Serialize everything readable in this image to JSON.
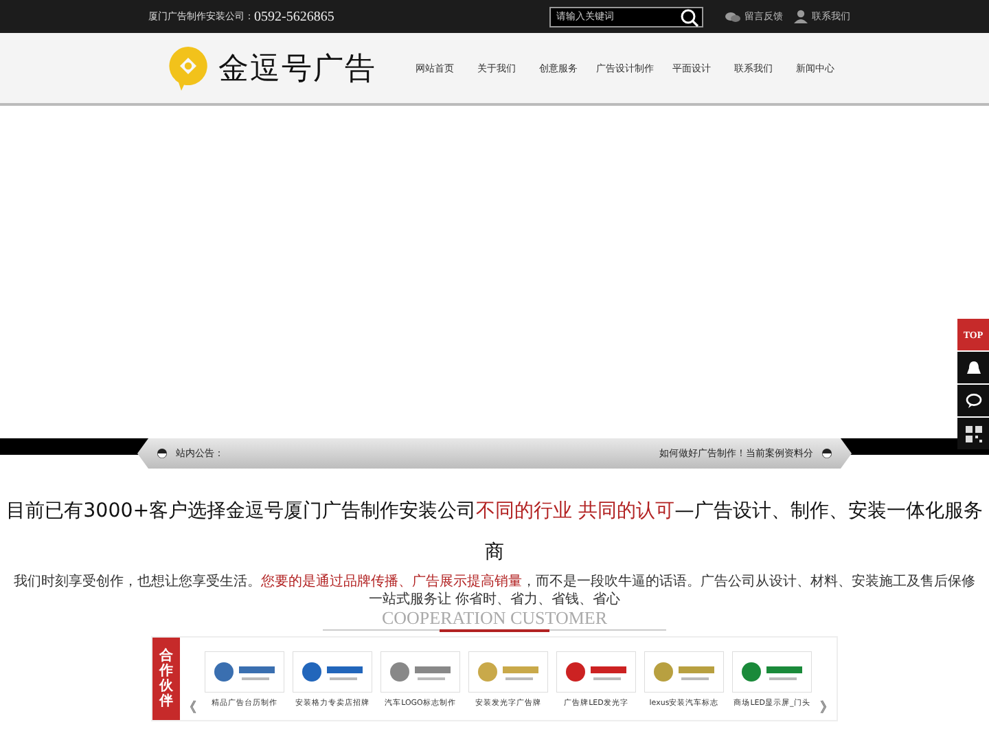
{
  "top_bar": {
    "company": "厦门广告制作安装公司：",
    "phone": "0592-5626865",
    "search": {
      "placeholder": "请输入关键词"
    },
    "links": [
      {
        "kind": "feedback",
        "label": "留言反馈"
      },
      {
        "kind": "contact",
        "label": "联系我们"
      }
    ]
  },
  "header": {
    "logo_text": "金逗号广告",
    "nav": [
      {
        "label": "网站首页"
      },
      {
        "label": "关于我们"
      },
      {
        "label": "创意服务"
      },
      {
        "label": "广告设计制作"
      },
      {
        "label": "平面设计"
      },
      {
        "label": "联系我们"
      },
      {
        "label": "新闻中心"
      }
    ]
  },
  "notice": {
    "label": "站内公告：",
    "message": "如何做好广告制作！当前案例资料分"
  },
  "side_tabs": [
    {
      "kind": "top",
      "label": "TOP"
    },
    {
      "kind": "qq"
    },
    {
      "kind": "chat"
    },
    {
      "kind": "qr"
    }
  ],
  "headline": [
    {
      "text": "目前已有3000+客户选择金逗号厦门广告制作安装公司",
      "highlight": false
    },
    {
      "text": "不同的行业 共同的认可",
      "highlight": true
    },
    {
      "text": "—广告设计、制作、安装一体化服务商",
      "highlight": false
    }
  ],
  "intro": [
    {
      "text": "我们时刻享受创作，也想让您享受生活。",
      "highlight": false
    },
    {
      "text": "您要的是通过品牌传播、广告展示提高销量",
      "highlight": true
    },
    {
      "text": "，而不是一段吹牛逼的话语。广告公司从设计、材料、安装施工及售后保修一站式服务让 你省时、省力、省钱、省心",
      "highlight": false
    }
  ],
  "cooperation": {
    "title": "COOPERATION CUSTOMER",
    "side_label": "合作伙伴",
    "prev": "《",
    "next": "》",
    "partners": [
      {
        "caption": "精品广告台历制作"
      },
      {
        "caption": "安装格力专卖店招牌"
      },
      {
        "caption": "汽车LOGO标志制作"
      },
      {
        "caption": "安装发光字广告牌"
      },
      {
        "caption": "广告牌LED发光字"
      },
      {
        "caption": "lexus安装汽车标志"
      },
      {
        "caption": "商场LED显示屏_门头"
      }
    ]
  }
}
